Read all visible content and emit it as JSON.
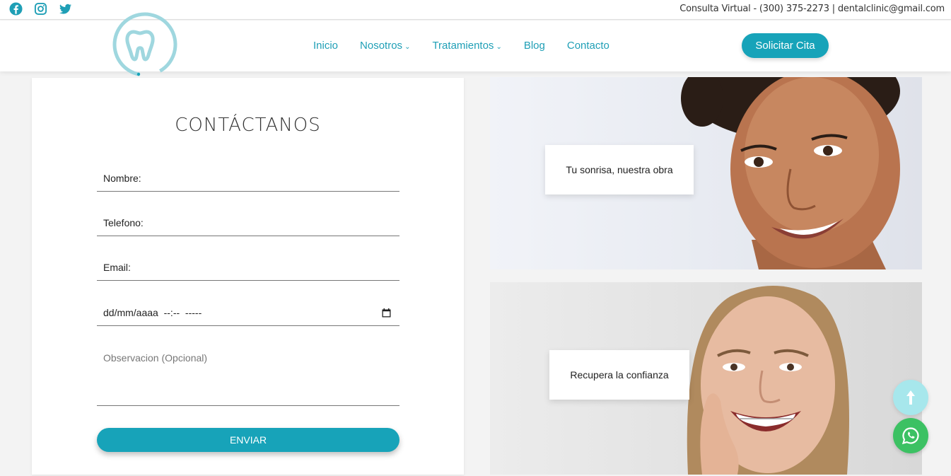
{
  "topbar": {
    "social_icons": [
      "facebook-icon",
      "instagram-icon",
      "twitter-icon"
    ],
    "contact_line": "Consulta Virtual - (300) 375-2273 | dentalclinic@gmail.com"
  },
  "header": {
    "logo_icon": "tooth-logo-icon",
    "nav": [
      {
        "label": "Inicio",
        "dropdown": false
      },
      {
        "label": "Nosotros",
        "dropdown": true
      },
      {
        "label": "Tratamientos",
        "dropdown": true
      },
      {
        "label": "Blog",
        "dropdown": false
      },
      {
        "label": "Contacto",
        "dropdown": false
      }
    ],
    "cta_label": "Solicitar Cita"
  },
  "form": {
    "title": "CONTÁCTANOS",
    "nombre_placeholder": "Nombre:",
    "telefono_placeholder": "Telefono:",
    "email_placeholder": "Email:",
    "datetime_value": "dd/mm/aaaa  --:--  -----",
    "observacion_placeholder": "Observacion (Opcional)",
    "submit_label": "ENVIAR"
  },
  "panels": [
    {
      "caption": "Tu sonrisa, nuestra obra"
    },
    {
      "caption": "Recupera la confianza"
    }
  ],
  "colors": {
    "brand": "#17a3b9",
    "nav_text": "#1f9fb6",
    "whatsapp": "#3cc163",
    "scroll_top": "#a7e7ec"
  },
  "floating": {
    "scroll_top_icon": "arrow-up-icon",
    "whatsapp_icon": "whatsapp-icon"
  }
}
